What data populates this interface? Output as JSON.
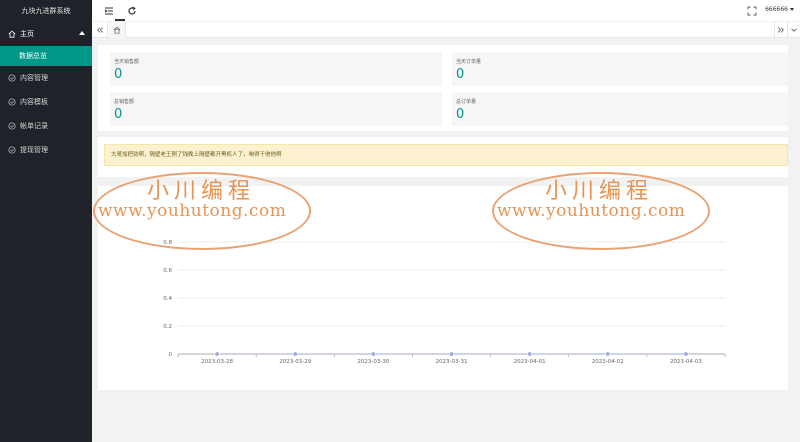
{
  "app_title": "九块九进群系统",
  "sidebar": {
    "home": "主页",
    "home_sub": "数据总览",
    "items": [
      {
        "label": "内容管理",
        "icon": "shield-check-icon"
      },
      {
        "label": "内容模板",
        "icon": "shield-check-icon"
      },
      {
        "label": "帐单记录",
        "icon": "shield-check-icon"
      },
      {
        "label": "提现管理",
        "icon": "shield-check-icon"
      }
    ]
  },
  "header": {
    "user": "666666"
  },
  "stats": [
    {
      "label": "当天销售额",
      "value": "0"
    },
    {
      "label": "当天订单量",
      "value": "0"
    },
    {
      "label": "总销售额",
      "value": "0"
    },
    {
      "label": "总订单量",
      "value": "0"
    }
  ],
  "notice": "大哥加把劲啊，隔壁老王刚了钱晚上隔壁都开黑机人了，咱得干他他啊",
  "watermarks": [
    {
      "title": "小川编程",
      "url": "www.youhutong.com"
    },
    {
      "title": "小川编程",
      "url": "www.youhutong.com"
    }
  ],
  "chart_data": {
    "type": "line",
    "categories": [
      "2023-03-28",
      "2023-03-29",
      "2023-03-30",
      "2023-03-31",
      "2023-04-01",
      "2023-04-02",
      "2023-04-03"
    ],
    "series": [
      {
        "values": [
          0,
          0,
          0,
          0,
          0,
          0,
          0
        ],
        "color": "#9fa8da"
      }
    ],
    "yticks": [
      "0",
      "0.2",
      "0.4",
      "0.6",
      "0.8"
    ],
    "ylim": [
      0,
      1
    ],
    "grid": true
  }
}
